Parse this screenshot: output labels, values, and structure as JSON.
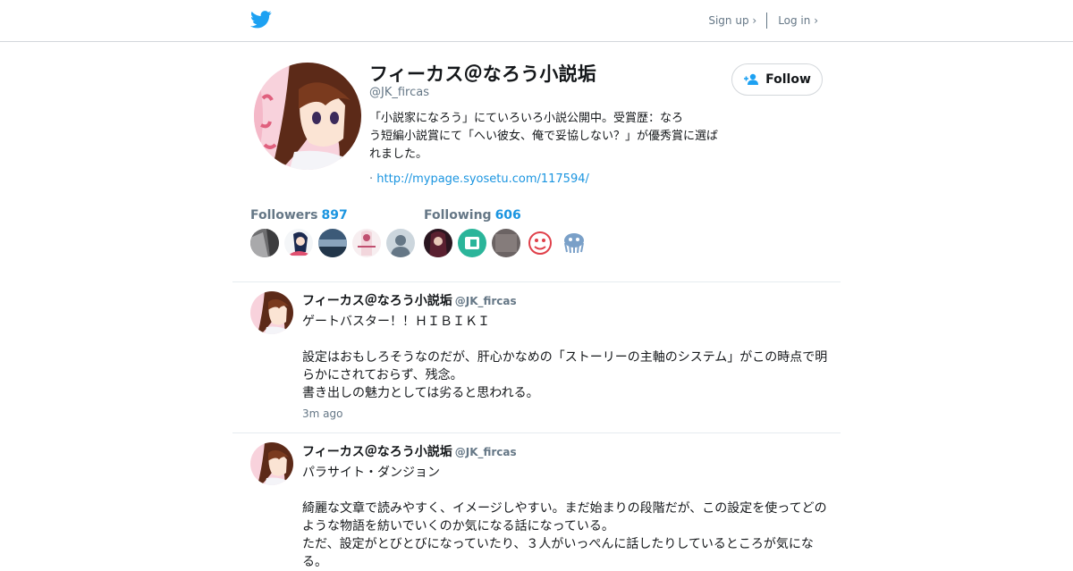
{
  "topbar": {
    "signup_label": "Sign up ›",
    "login_label": "Log in ›",
    "logo_icon": "twitter-bird-icon",
    "accent": "#1da1f2"
  },
  "profile": {
    "name": "フィーカス＠なろう小説垢",
    "handle": "@JK_fircas",
    "bio": [
      "「小説家になろう」にていろいろ小説公開中。受賞歴：なろ",
      "う短編小説賞にて「へい彼女、俺で妥協しない？」が優秀賞に選ば",
      "れました。"
    ],
    "link_prefix": "·",
    "link": "http://mypage.syosetu.com/117594/",
    "follow_label": "Follow",
    "follow_icon": "add-person-icon",
    "followers_label": "Followers",
    "followers_count": "897",
    "following_label": "Following",
    "following_count": "606"
  },
  "tweets": [
    {
      "name": "フィーカス＠なろう小説垢",
      "handle": "@JK_fircas",
      "lines": [
        "ゲートバスター！！ＨＩＢＩＫＩ",
        "",
        "設定はおもしろそうなのだが、肝心かなめの「ストーリーの主軸のシステム」がこの時点で明",
        "らかにされておらず、残念。",
        "書き出しの魅力としては劣ると思われる。"
      ],
      "time": "3m ago"
    },
    {
      "name": "フィーカス＠なろう小説垢",
      "handle": "@JK_fircas",
      "lines": [
        "パラサイト・ダンジョン",
        "",
        "綺麗な文章で読みやすく、イメージしやすい。まだ始まりの段階だが、この設定を使ってどの",
        "ような物語を紡いでいくのか気になる話になっている。",
        "ただ、設定がとびとびになっていたり、３人がいっぺんに話したりしているところが気にな",
        "る。"
      ],
      "time": ""
    }
  ]
}
